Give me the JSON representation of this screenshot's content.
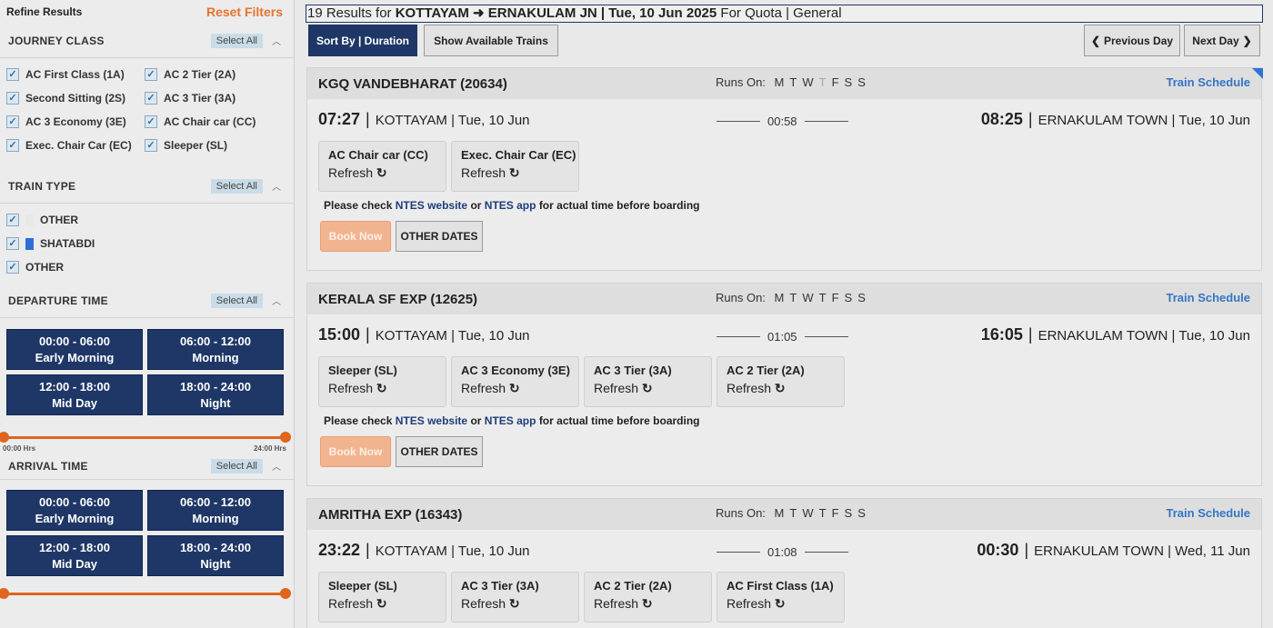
{
  "sidebar": {
    "title": "Refine Results",
    "reset": "Reset Filters",
    "journey_class": {
      "heading": "JOURNEY CLASS",
      "select_all": "Select All",
      "items": [
        "AC First Class (1A)",
        "AC 2 Tier (2A)",
        "Second Sitting (2S)",
        "AC 3 Tier (3A)",
        "AC 3 Economy (3E)",
        "AC Chair car (CC)",
        "Exec. Chair Car (EC)",
        "Sleeper (SL)"
      ]
    },
    "train_type": {
      "heading": "TRAIN TYPE",
      "select_all": "Select All",
      "items": [
        {
          "label": "OTHER",
          "color": "#e8e8e8"
        },
        {
          "label": "SHATABDI",
          "color": "#2d6fd6"
        },
        {
          "label": "OTHER",
          "color": ""
        }
      ]
    },
    "departure": {
      "heading": "DEPARTURE TIME",
      "select_all": "Select All",
      "slots": [
        {
          "range": "00:00 - 06:00",
          "name": "Early Morning"
        },
        {
          "range": "06:00 - 12:00",
          "name": "Morning"
        },
        {
          "range": "12:00 - 18:00",
          "name": "Mid Day"
        },
        {
          "range": "18:00 - 24:00",
          "name": "Night"
        }
      ],
      "slider_min": "00:00 Hrs",
      "slider_max": "24:00 Hrs"
    },
    "arrival": {
      "heading": "ARRIVAL TIME",
      "select_all": "Select All",
      "slots": [
        {
          "range": "00:00 - 06:00",
          "name": "Early Morning"
        },
        {
          "range": "06:00 - 12:00",
          "name": "Morning"
        },
        {
          "range": "12:00 - 18:00",
          "name": "Mid Day"
        },
        {
          "range": "18:00 - 24:00",
          "name": "Night"
        }
      ]
    }
  },
  "header": {
    "count": "19 Results for",
    "route": "KOTTAYAM ➜ ERNAKULAM JN | Tue, 10 Jun 2025",
    "quota": "For Quota | General"
  },
  "toolbar": {
    "sort": "Sort By | Duration",
    "available": "Show Available Trains",
    "prev": "Previous Day",
    "next": "Next Day"
  },
  "common": {
    "runs_on": "Runs On:",
    "schedule": "Train Schedule",
    "refresh": "Refresh",
    "refresh_icon": "↻",
    "note_pre": "Please check",
    "note_link1": "NTES website",
    "note_or": "or",
    "note_link2": "NTES app",
    "note_post": "for actual time before boarding",
    "book": "Book Now",
    "other_dates": "OTHER DATES"
  },
  "trains": [
    {
      "name": "KGQ VANDEBHARAT (20634)",
      "days": [
        "M",
        "T",
        "W",
        "T",
        "F",
        "S",
        "S"
      ],
      "dep_time": "07:27",
      "dep_station": "KOTTAYAM | Tue, 10 Jun",
      "duration": "00:58",
      "arr_time": "08:25",
      "arr_station": "ERNAKULAM TOWN | Tue, 10 Jun",
      "classes": [
        "AC Chair car (CC)",
        "Exec. Chair Car (EC)"
      ]
    },
    {
      "name": "KERALA SF EXP (12625)",
      "days": [
        "M",
        "T",
        "W",
        "T",
        "F",
        "S",
        "S"
      ],
      "dep_time": "15:00",
      "dep_station": "KOTTAYAM | Tue, 10 Jun",
      "duration": "01:05",
      "arr_time": "16:05",
      "arr_station": "ERNAKULAM TOWN | Tue, 10 Jun",
      "classes": [
        "Sleeper (SL)",
        "AC 3 Economy (3E)",
        "AC 3 Tier (3A)",
        "AC 2 Tier (2A)"
      ]
    },
    {
      "name": "AMRITHA EXP (16343)",
      "days": [
        "M",
        "T",
        "W",
        "T",
        "F",
        "S",
        "S"
      ],
      "dep_time": "23:22",
      "dep_station": "KOTTAYAM | Tue, 10 Jun",
      "duration": "01:08",
      "arr_time": "00:30",
      "arr_station": "ERNAKULAM TOWN | Wed, 11 Jun",
      "classes": [
        "Sleeper (SL)",
        "AC 3 Tier (3A)",
        "AC 2 Tier (2A)",
        "AC First Class (1A)"
      ]
    }
  ]
}
